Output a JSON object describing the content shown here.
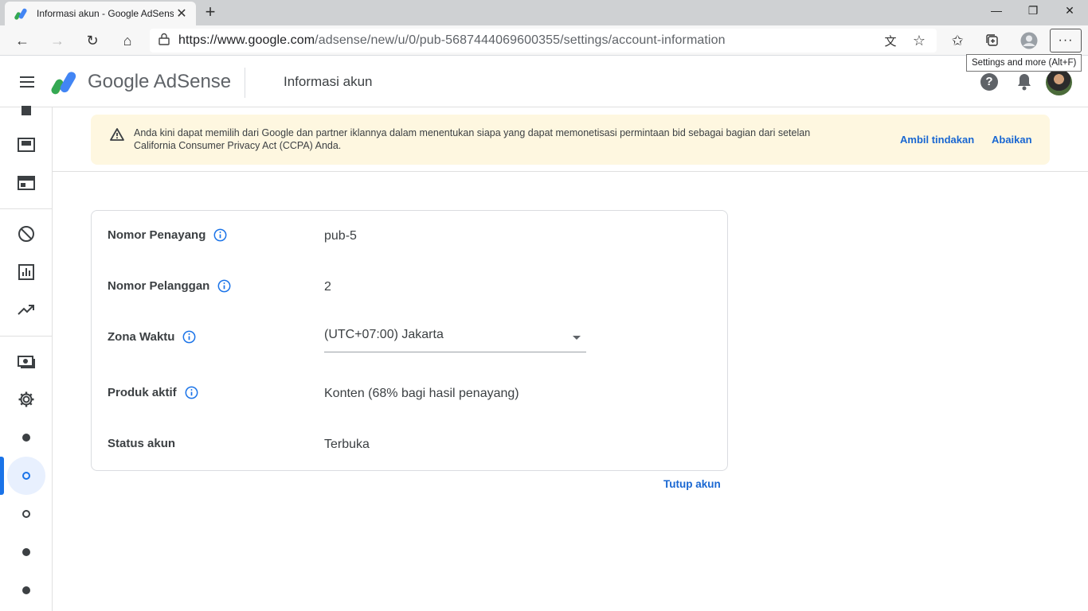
{
  "browser": {
    "tab_title": "Informasi akun - Google AdSense",
    "url_host": "https://www.google.com",
    "url_path": "/adsense/new/u/0/pub-5687444069600355/settings/account-information",
    "tooltip": "Settings and more (Alt+F)",
    "icons": [
      "back-icon",
      "forward-icon",
      "refresh-icon",
      "home-icon",
      "lock-icon",
      "translate-icon",
      "star-icon",
      "favorites-icon",
      "collections-icon",
      "profile-icon",
      "more-icon"
    ]
  },
  "header": {
    "logo_text": "Google AdSense",
    "page_title": "Informasi akun"
  },
  "banner": {
    "text": "Anda kini dapat memilih dari Google dan partner iklannya dalam menentukan siapa yang dapat memonetisasi permintaan bid sebagai bagian dari setelan California Consumer Privacy Act (CCPA) Anda.",
    "action_label": "Ambil tindakan",
    "dismiss_label": "Abaikan"
  },
  "account": {
    "rows": [
      {
        "label": "Nomor Penayang",
        "value": "pub-5"
      },
      {
        "label": "Nomor Pelanggan",
        "value": "2"
      },
      {
        "label": "Zona Waktu",
        "value": "(UTC+07:00) Jakarta"
      },
      {
        "label": "Produk aktif",
        "value": "Konten (68% bagi hasil penayang)"
      },
      {
        "label": "Status akun",
        "value": "Terbuka"
      }
    ],
    "close_label": "Tutup akun"
  },
  "colors": {
    "accent": "#1a73e8",
    "banner_bg": "#fef7e0",
    "link": "#1967d2"
  }
}
